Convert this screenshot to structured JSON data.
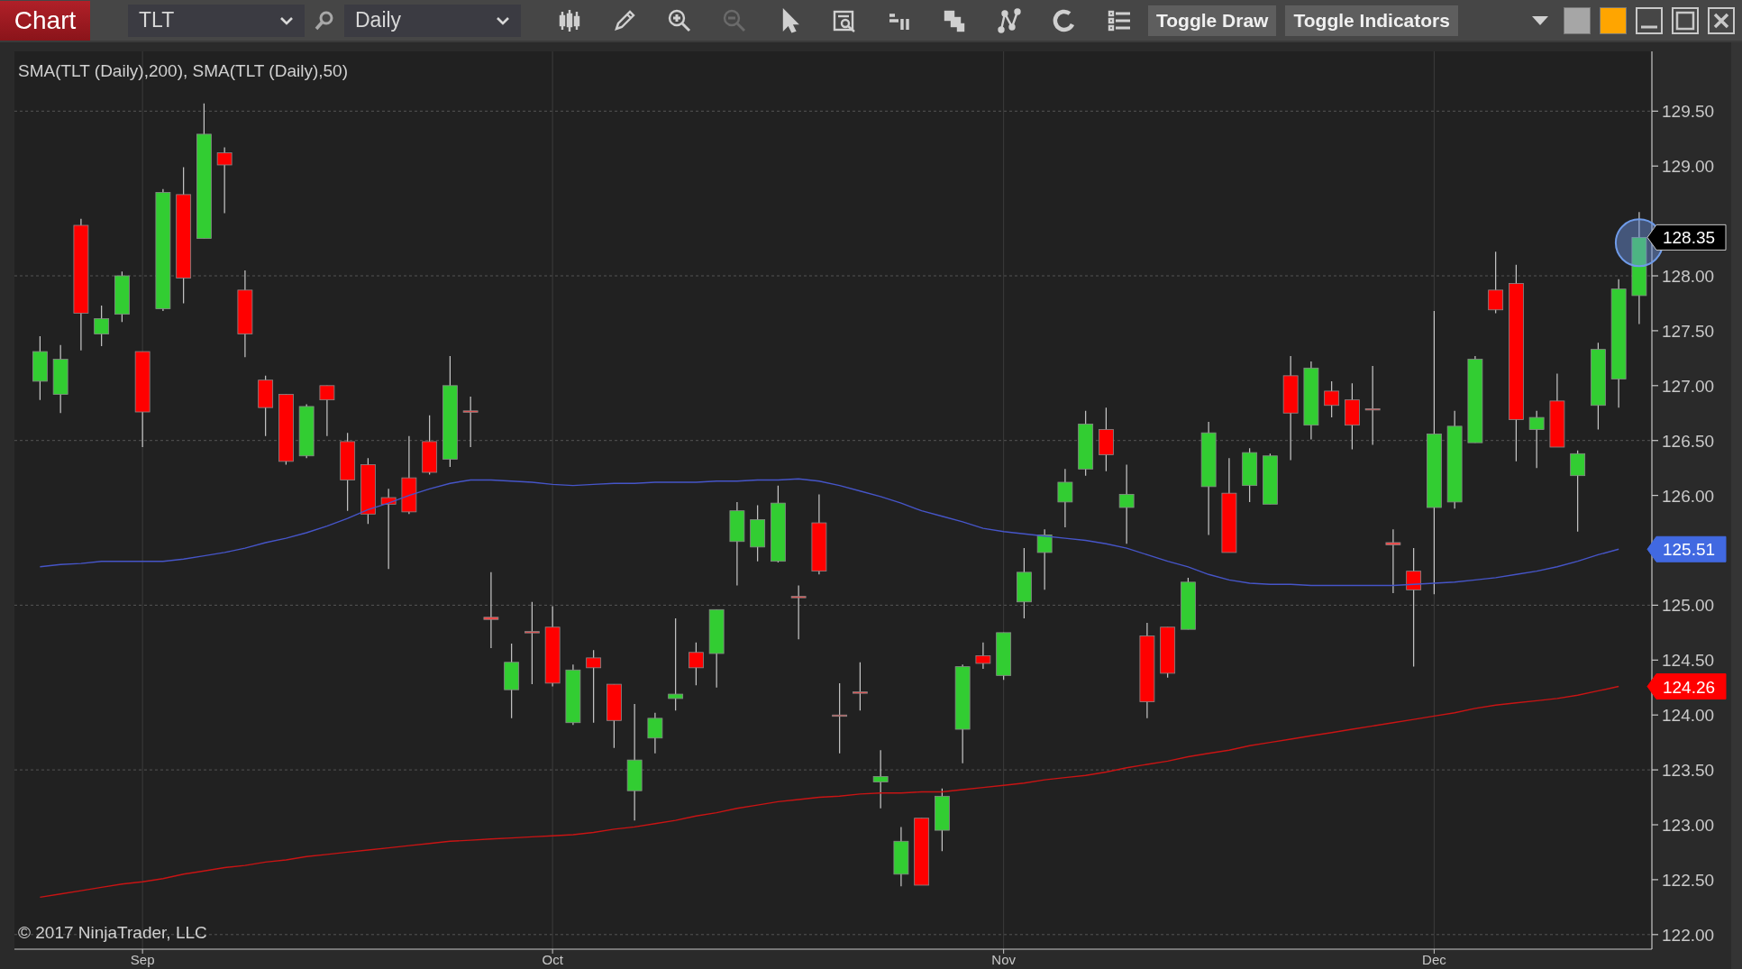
{
  "toolbar": {
    "chart_button": "Chart",
    "instrument": "TLT",
    "interval": "Daily",
    "tool_icons": [
      {
        "disabled": false
      },
      {
        "disabled": false
      },
      {
        "disabled": false
      },
      {
        "disabled": true
      },
      {
        "disabled": false
      },
      {
        "disabled": false
      },
      {
        "disabled": false
      },
      {
        "disabled": false
      },
      {
        "disabled": false
      },
      {
        "disabled": false
      },
      {
        "disabled": false
      }
    ],
    "buttons": [
      "Toggle Draw",
      "Toggle Indicators"
    ],
    "swatches": [
      {
        "color": "#a6a6a6"
      },
      {
        "color": "#ffa500"
      }
    ]
  },
  "chart": {
    "copyright": "© 2017 NinjaTrader, LLC",
    "price_markers": [
      {
        "text": "128.35",
        "color": "#000000"
      },
      {
        "text": "125.51",
        "color": "#4169e1"
      },
      {
        "text": "124.26",
        "color": "#ff0000"
      }
    ],
    "chart_data": {
      "type": "candlestick",
      "title": "SMA(TLT (Daily),200), SMA(TLT (Daily),50)",
      "grid": true,
      "categories": [
        null,
        null,
        null,
        null,
        null,
        "Sep",
        null,
        null,
        null,
        null,
        null,
        null,
        null,
        null,
        null,
        null,
        null,
        null,
        null,
        null,
        null,
        null,
        null,
        null,
        null,
        "Oct",
        null,
        null,
        null,
        null,
        null,
        null,
        null,
        null,
        null,
        null,
        null,
        null,
        null,
        null,
        null,
        null,
        null,
        null,
        null,
        null,
        null,
        "Nov",
        null,
        null,
        null,
        null,
        null,
        null,
        null,
        null,
        null,
        null,
        null,
        null,
        null,
        null,
        null,
        null,
        null,
        null,
        null,
        null,
        "Dec",
        null,
        null,
        null,
        null,
        null,
        null,
        null,
        null,
        null,
        null
      ],
      "ylim": [
        122.0,
        129.5
      ],
      "yticks": [
        {
          "value": 122.0,
          "label": "122.00"
        },
        {
          "value": 122.5,
          "label": "122.50"
        },
        {
          "value": 123.0,
          "label": "123.00"
        },
        {
          "value": 123.5,
          "label": "123.50"
        },
        {
          "value": 124.0,
          "label": "124.00"
        },
        {
          "value": 124.5,
          "label": "124.50"
        },
        {
          "value": 125.0,
          "label": "125.00"
        },
        {
          "value": 126.0,
          "label": "126.00"
        },
        {
          "value": 126.5,
          "label": "126.50"
        },
        {
          "value": 127.0,
          "label": "127.00"
        },
        {
          "value": 127.5,
          "label": "127.50"
        },
        {
          "value": 128.0,
          "label": "128.00"
        },
        {
          "value": 129.0,
          "label": "129.00"
        },
        {
          "value": 129.5,
          "label": "129.50"
        }
      ],
      "ohlc": [
        [
          127.04,
          127.45,
          126.87,
          127.31
        ],
        [
          126.92,
          127.37,
          126.75,
          127.24
        ],
        [
          128.46,
          128.52,
          127.32,
          127.66
        ],
        [
          127.47,
          127.73,
          127.36,
          127.61
        ],
        [
          127.65,
          128.04,
          127.58,
          128.0
        ],
        [
          127.31,
          127.31,
          126.44,
          126.76
        ],
        [
          127.7,
          128.79,
          127.68,
          128.76
        ],
        [
          128.74,
          128.99,
          127.75,
          127.98
        ],
        [
          128.34,
          129.57,
          128.34,
          129.29
        ],
        [
          129.12,
          129.17,
          128.57,
          129.01
        ],
        [
          127.87,
          128.05,
          127.26,
          127.47
        ],
        [
          127.05,
          127.09,
          126.54,
          126.8
        ],
        [
          126.92,
          126.92,
          126.28,
          126.31
        ],
        [
          126.36,
          126.83,
          126.34,
          126.81
        ],
        [
          127.0,
          127.0,
          126.54,
          126.87
        ],
        [
          126.49,
          126.57,
          125.86,
          126.14
        ],
        [
          126.28,
          126.34,
          125.74,
          125.83
        ],
        [
          125.98,
          126.06,
          125.33,
          125.92
        ],
        [
          126.16,
          126.54,
          125.83,
          125.85
        ],
        [
          126.49,
          126.73,
          126.19,
          126.21
        ],
        [
          126.33,
          127.27,
          126.26,
          127.0
        ],
        [
          126.77,
          126.9,
          126.44,
          126.76
        ],
        [
          124.89,
          125.3,
          124.61,
          124.87
        ],
        [
          124.23,
          124.65,
          123.97,
          124.48
        ],
        [
          124.76,
          125.03,
          124.28,
          124.76
        ],
        [
          124.8,
          124.99,
          124.26,
          124.29
        ],
        [
          123.93,
          124.46,
          123.91,
          124.41
        ],
        [
          124.52,
          124.59,
          123.93,
          124.43
        ],
        [
          124.28,
          124.28,
          123.7,
          123.95
        ],
        [
          123.31,
          124.1,
          123.04,
          123.59
        ],
        [
          123.79,
          124.02,
          123.65,
          123.97
        ],
        [
          124.15,
          124.88,
          124.04,
          124.19
        ],
        [
          124.57,
          124.66,
          124.27,
          124.43
        ],
        [
          124.56,
          124.96,
          124.25,
          124.96
        ],
        [
          125.58,
          125.94,
          125.18,
          125.86
        ],
        [
          125.53,
          125.91,
          125.4,
          125.78
        ],
        [
          125.4,
          126.09,
          125.39,
          125.93
        ],
        [
          125.08,
          125.18,
          124.69,
          125.07
        ],
        [
          125.75,
          126.01,
          125.28,
          125.31
        ],
        [
          124.0,
          124.29,
          123.65,
          123.99
        ],
        [
          124.2,
          124.48,
          124.04,
          124.21
        ],
        [
          123.39,
          123.68,
          123.15,
          123.44
        ],
        [
          122.55,
          122.98,
          122.44,
          122.85
        ],
        [
          123.06,
          123.06,
          122.45,
          122.45
        ],
        [
          122.95,
          123.33,
          122.76,
          123.26
        ],
        [
          123.87,
          124.46,
          123.56,
          124.44
        ],
        [
          124.54,
          124.66,
          124.42,
          124.47
        ],
        [
          124.36,
          124.75,
          124.32,
          124.75
        ],
        [
          125.03,
          125.52,
          124.88,
          125.3
        ],
        [
          125.48,
          125.69,
          125.14,
          125.64
        ],
        [
          125.94,
          126.24,
          125.71,
          126.12
        ],
        [
          126.24,
          126.77,
          126.18,
          126.65
        ],
        [
          126.6,
          126.8,
          126.22,
          126.37
        ],
        [
          125.89,
          126.28,
          125.56,
          126.01
        ],
        [
          124.72,
          124.84,
          123.97,
          124.12
        ],
        [
          124.8,
          124.8,
          124.34,
          124.38
        ],
        [
          124.78,
          125.25,
          124.78,
          125.21
        ],
        [
          126.08,
          126.67,
          125.64,
          126.57
        ],
        [
          126.02,
          126.34,
          125.48,
          125.48
        ],
        [
          126.09,
          126.43,
          125.94,
          126.39
        ],
        [
          125.92,
          126.38,
          125.92,
          126.36
        ],
        [
          127.09,
          127.27,
          126.32,
          126.75
        ],
        [
          126.64,
          127.22,
          126.51,
          127.16
        ],
        [
          126.95,
          127.04,
          126.71,
          126.82
        ],
        [
          126.87,
          127.02,
          126.42,
          126.64
        ],
        [
          126.79,
          127.18,
          126.46,
          126.78
        ],
        [
          125.57,
          125.69,
          125.11,
          125.55
        ],
        [
          125.31,
          125.52,
          124.44,
          125.14
        ],
        [
          125.89,
          127.68,
          125.1,
          126.56
        ],
        [
          125.94,
          126.77,
          125.88,
          126.63
        ],
        [
          126.48,
          127.27,
          126.48,
          127.24
        ],
        [
          127.87,
          128.22,
          127.66,
          127.69
        ],
        [
          127.93,
          128.1,
          126.31,
          126.69
        ],
        [
          126.6,
          126.77,
          126.25,
          126.71
        ],
        [
          126.86,
          127.11,
          126.44,
          126.44
        ],
        [
          126.18,
          126.41,
          125.67,
          126.38
        ],
        [
          126.82,
          127.39,
          126.6,
          127.33
        ],
        [
          127.06,
          127.97,
          126.8,
          127.88
        ],
        [
          127.82,
          128.58,
          127.56,
          128.35
        ]
      ],
      "series": [
        {
          "type": "line",
          "color": "#c81414",
          "values": [
            122.34,
            122.37,
            122.4,
            122.43,
            122.46,
            122.48,
            122.51,
            122.55,
            122.58,
            122.61,
            122.63,
            122.66,
            122.68,
            122.71,
            122.73,
            122.75,
            122.77,
            122.79,
            122.81,
            122.83,
            122.85,
            122.86,
            122.87,
            122.88,
            122.89,
            122.9,
            122.91,
            122.93,
            122.96,
            122.98,
            123.01,
            123.04,
            123.08,
            123.11,
            123.15,
            123.18,
            123.21,
            123.23,
            123.25,
            123.26,
            123.28,
            123.29,
            123.29,
            123.3,
            123.3,
            123.32,
            123.34,
            123.36,
            123.38,
            123.41,
            123.43,
            123.45,
            123.48,
            123.52,
            123.55,
            123.58,
            123.62,
            123.65,
            123.68,
            123.72,
            123.75,
            123.78,
            123.81,
            123.84,
            123.87,
            123.9,
            123.93,
            123.96,
            123.99,
            124.02,
            124.06,
            124.09,
            124.11,
            124.13,
            124.15,
            124.18,
            124.22,
            124.26,
            null
          ]
        },
        {
          "type": "line",
          "color": "#4655c8",
          "values": [
            125.35,
            125.37,
            125.38,
            125.4,
            125.4,
            125.4,
            125.4,
            125.42,
            125.45,
            125.48,
            125.52,
            125.57,
            125.61,
            125.66,
            125.72,
            125.79,
            125.87,
            125.93,
            126.0,
            126.06,
            126.11,
            126.14,
            126.14,
            126.13,
            126.12,
            126.1,
            126.09,
            126.1,
            126.11,
            126.11,
            126.12,
            126.12,
            126.12,
            126.13,
            126.13,
            126.14,
            126.14,
            126.15,
            126.13,
            126.09,
            126.04,
            125.99,
            125.93,
            125.86,
            125.81,
            125.76,
            125.7,
            125.67,
            125.65,
            125.63,
            125.61,
            125.59,
            125.56,
            125.52,
            125.46,
            125.4,
            125.35,
            125.28,
            125.23,
            125.2,
            125.19,
            125.19,
            125.18,
            125.18,
            125.18,
            125.18,
            125.18,
            125.19,
            125.2,
            125.21,
            125.23,
            125.25,
            125.28,
            125.31,
            125.35,
            125.4,
            125.46,
            125.51,
            null
          ]
        }
      ]
    }
  }
}
